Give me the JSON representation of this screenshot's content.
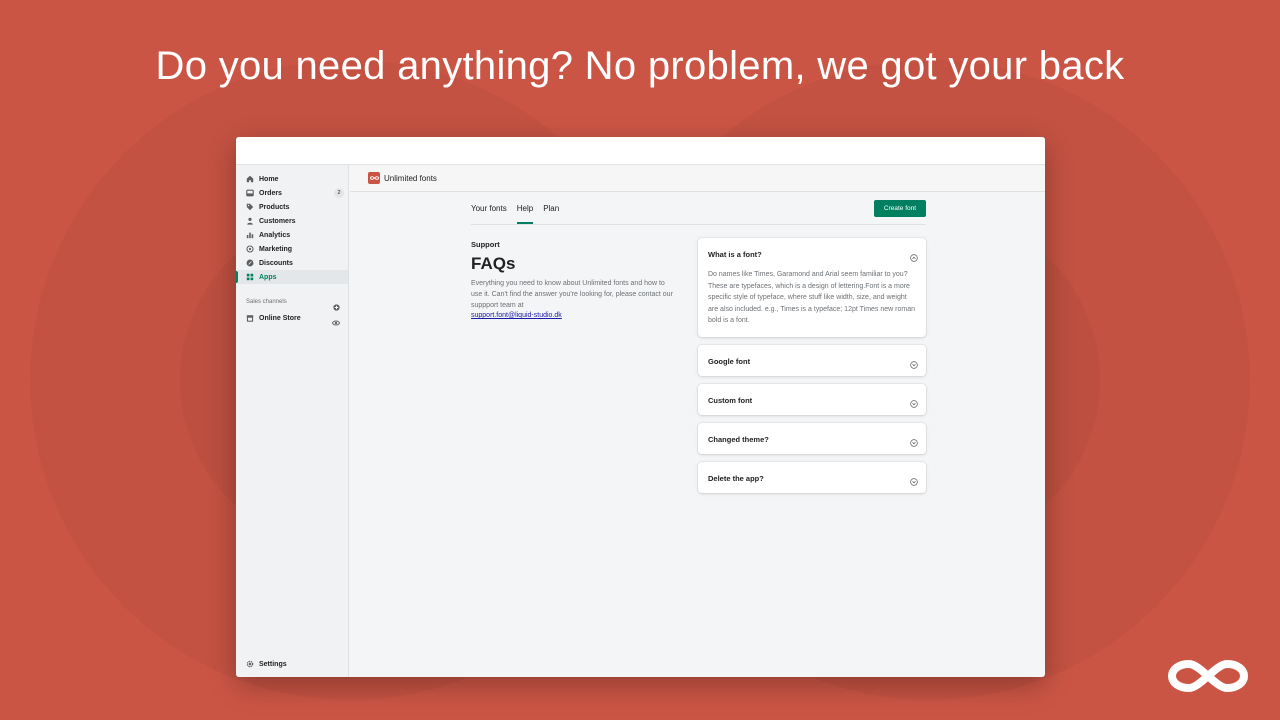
{
  "headline": "Do you need anything? No problem, we got your back",
  "colors": {
    "background": "#cb5545",
    "accent": "#008060",
    "logo": "#cb5545"
  },
  "sidebar": {
    "items": [
      {
        "label": "Home",
        "icon": "home-icon"
      },
      {
        "label": "Orders",
        "icon": "orders-icon",
        "badge": "2"
      },
      {
        "label": "Products",
        "icon": "tag-icon"
      },
      {
        "label": "Customers",
        "icon": "person-icon"
      },
      {
        "label": "Analytics",
        "icon": "bar-chart-icon"
      },
      {
        "label": "Marketing",
        "icon": "target-icon"
      },
      {
        "label": "Discounts",
        "icon": "discount-icon"
      },
      {
        "label": "Apps",
        "icon": "apps-icon",
        "active": true
      }
    ],
    "sales_channels_label": "Sales channels",
    "online_store_label": "Online Store",
    "settings_label": "Settings"
  },
  "app": {
    "title": "Unlimited fonts",
    "logo_icon": "infinity-icon"
  },
  "tabs": [
    {
      "label": "Your fonts"
    },
    {
      "label": "Help",
      "active": true
    },
    {
      "label": "Plan"
    }
  ],
  "create_button": "Create font",
  "support": {
    "label": "Support",
    "title": "FAQs",
    "intro": "Everything you need to know about Unlimited fonts and how to use it. Can't find the answer you're looking for, please contact our suppport team at",
    "email": "support.font@liquid-studio.dk"
  },
  "faqs": [
    {
      "question": "What is a font?",
      "answer": "Do names like Times, Garamond and Arial seem familiar to you? These are typefaces, which is a design of lettering.Font is a more specific style of typeface, where stuff like width, size, and weight are also included. e.g., Times is a typeface; 12pt Times new roman bold is a font.",
      "expanded": true
    },
    {
      "question": "Google font",
      "expanded": false
    },
    {
      "question": "Custom font",
      "expanded": false
    },
    {
      "question": "Changed theme?",
      "expanded": false
    },
    {
      "question": "Delete the app?",
      "expanded": false
    }
  ]
}
